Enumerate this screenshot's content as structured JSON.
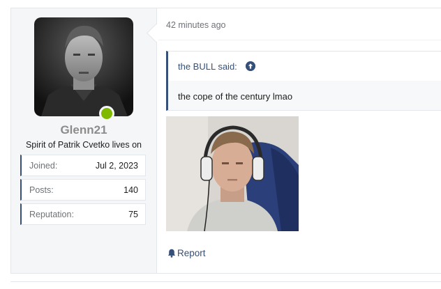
{
  "post": {
    "user": {
      "username": "Glenn21",
      "user_title": "Spirit of Patrik Cvetko lives on",
      "online": true,
      "stats": [
        {
          "label": "Joined:",
          "value": "Jul 2, 2023"
        },
        {
          "label": "Posts:",
          "value": "140"
        },
        {
          "label": "Reputation:",
          "value": "75"
        }
      ]
    },
    "timestamp": "42 minutes ago",
    "quote": {
      "author_line": "the BULL said:",
      "jump_icon": "arrow-up-circle-icon",
      "text": "the cope of the century lmao"
    },
    "attachment": {
      "kind": "webcam-photo",
      "description_icon": "photo"
    },
    "actions": {
      "report_label": "Report",
      "report_icon": "bell-icon"
    }
  },
  "colors": {
    "accent": "#36507a",
    "online": "#7fb900",
    "sidebar_bg": "#f5f6f8",
    "muted_text": "#6f7378"
  }
}
